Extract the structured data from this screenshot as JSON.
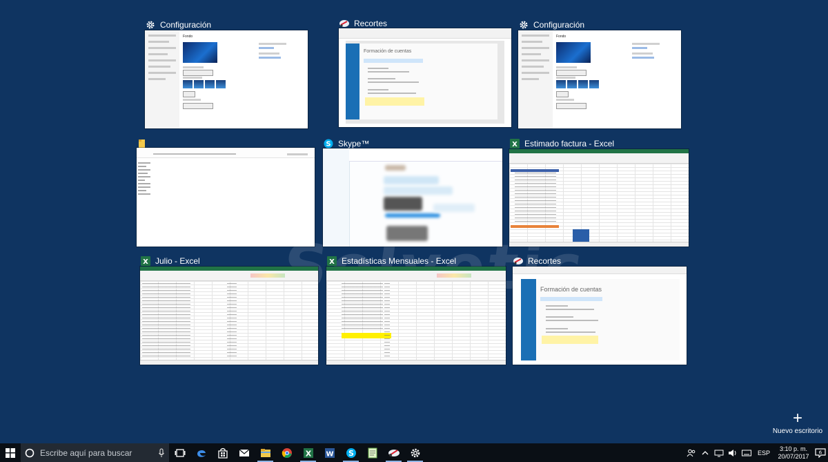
{
  "windows": [
    {
      "id": "settings1",
      "title": "Configuración",
      "icon": "gear-icon"
    },
    {
      "id": "recortes1",
      "title": "Recortes",
      "icon": "snipping-tool-icon"
    },
    {
      "id": "settings2",
      "title": "Configuración",
      "icon": "gear-icon"
    },
    {
      "id": "explorer",
      "title": "",
      "icon": "folder-icon"
    },
    {
      "id": "skype",
      "title": "Skype™",
      "icon": "skype-icon"
    },
    {
      "id": "estimado",
      "title": "Estimado factura - Excel",
      "icon": "excel-icon"
    },
    {
      "id": "julio",
      "title": "Julio - Excel",
      "icon": "excel-icon"
    },
    {
      "id": "estadisticas",
      "title": "Estadísticas Mensuales - Excel",
      "icon": "excel-icon"
    },
    {
      "id": "recortes2",
      "title": "Recortes",
      "icon": "snipping-tool-icon"
    }
  ],
  "settings_thumb": {
    "section": "Fondo"
  },
  "recortes_thumb": {
    "heading": "Formación de cuentas"
  },
  "watermark": "Solvetic",
  "new_desktop": {
    "label": "Nuevo escritorio"
  },
  "taskbar": {
    "search_placeholder": "Escribe aquí para buscar",
    "apps": [
      "task-view-icon",
      "edge-icon",
      "store-icon",
      "mail-icon",
      "file-explorer-icon",
      "chrome-icon",
      "excel-icon",
      "word-icon",
      "skype-icon",
      "notepad-icon",
      "snipping-tool-icon",
      "settings-icon"
    ],
    "language": "ESP",
    "time": "3:10 p. m.",
    "date": "20/07/2017",
    "notification_count": "6"
  },
  "colors": {
    "desktop": "#0f3461",
    "excel": "#217346",
    "skype": "#00aff0",
    "taskbar": "#0a0f15"
  }
}
